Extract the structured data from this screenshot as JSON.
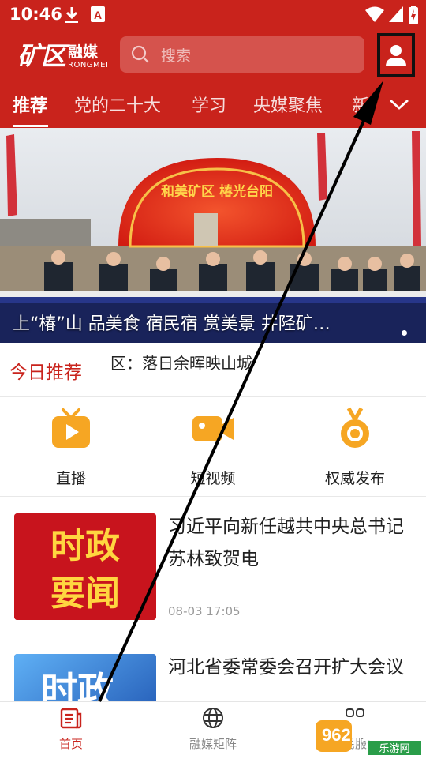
{
  "status_bar": {
    "time": "10:46"
  },
  "header": {
    "logo_big": "矿区",
    "logo_cn": "融媒",
    "logo_en": "RONGMEI",
    "search_placeholder": "搜索"
  },
  "tabs": [
    "推荐",
    "党的二十大",
    "学习",
    "央媒聚焦",
    "新"
  ],
  "banner": {
    "caption": "上“椿”山 品美食 宿民宿 赏美景 井陉矿…",
    "arch_text": "和美矿区 椿光台阳"
  },
  "today": {
    "label": "今日推荐",
    "text": "区：落日余晖映山城"
  },
  "quick_links": [
    {
      "label": "直播",
      "icon": "tv-icon"
    },
    {
      "label": "短视频",
      "icon": "video-camera-icon"
    },
    {
      "label": "权威发布",
      "icon": "medal-icon"
    }
  ],
  "news": [
    {
      "title": "习近平向新任越共中央总书记苏林致贺电",
      "time": "08-03 17:05",
      "thumb_text": [
        "时政",
        "要闻"
      ]
    },
    {
      "title": "河北省委常委会召开扩大会议",
      "time": "",
      "thumb_text": [
        "时政"
      ]
    }
  ],
  "bottom_nav": [
    {
      "label": "首页",
      "active": true
    },
    {
      "label": "融媒矩阵",
      "active": false
    },
    {
      "label": "便民服务",
      "active": false
    }
  ],
  "watermark": {
    "brand": "962.NET",
    "sub": "乐游网"
  },
  "colors": {
    "brand_red": "#c9231c",
    "accent_orange": "#f6a623"
  }
}
